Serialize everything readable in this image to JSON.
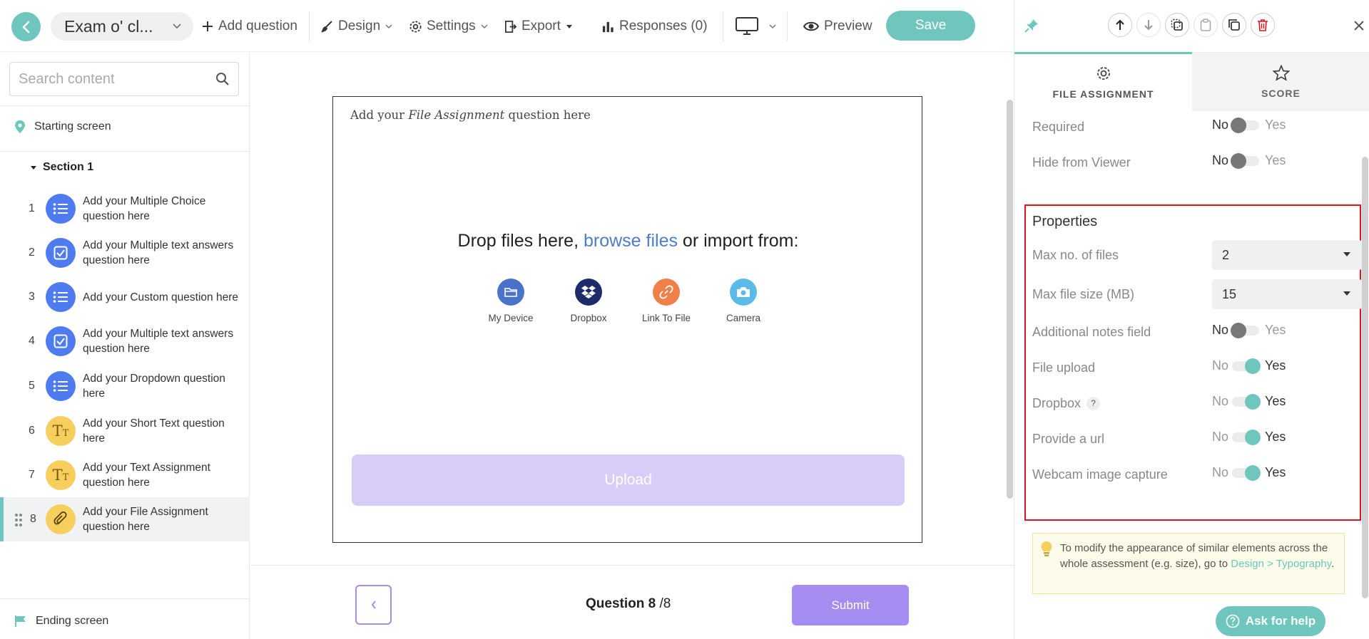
{
  "header": {
    "title": "Exam o' cl...",
    "add_question": "Add question",
    "design": "Design",
    "settings": "Settings",
    "export": "Export",
    "responses": "Responses (0)",
    "preview": "Preview",
    "save": "Save"
  },
  "sidebar": {
    "search_placeholder": "Search content",
    "starting_screen": "Starting screen",
    "section": "Section 1",
    "questions": [
      {
        "num": "1",
        "label": "Add your Multiple Choice question here",
        "icon": "list-icon",
        "color": "#4e7cf0"
      },
      {
        "num": "2",
        "label": "Add your Multiple text answers question here",
        "icon": "checkbox-icon",
        "color": "#4e7cf0"
      },
      {
        "num": "3",
        "label": "Add your Custom question here",
        "icon": "list-icon",
        "color": "#4e7cf0"
      },
      {
        "num": "4",
        "label": "Add your Multiple text answers question here",
        "icon": "checkbox-icon",
        "color": "#4e7cf0"
      },
      {
        "num": "5",
        "label": "Add your Dropdown question here",
        "icon": "list-icon",
        "color": "#4e7cf0"
      },
      {
        "num": "6",
        "label": "Add your Short Text question here",
        "icon": "text-icon",
        "color": "#f6cf5e"
      },
      {
        "num": "7",
        "label": "Add your Text Assignment question here",
        "icon": "text-icon",
        "color": "#f6cf5e"
      },
      {
        "num": "8",
        "label": "Add your File Assignment question here",
        "icon": "paperclip-icon",
        "color": "#f6cf5e"
      }
    ],
    "ending_screen": "Ending screen"
  },
  "canvas": {
    "question_prefix": "Add your ",
    "question_italic": "File Assignment",
    "question_suffix": " question here",
    "drop_prefix": "Drop files here, ",
    "drop_link": "browse files",
    "drop_suffix": " or import from:",
    "sources": [
      {
        "label": "My Device",
        "icon": "folder-icon",
        "color": "#4a72c8"
      },
      {
        "label": "Dropbox",
        "icon": "dropbox-icon",
        "color": "#1f2a6b"
      },
      {
        "label": "Link To File",
        "icon": "link-icon",
        "color": "#ef8049"
      },
      {
        "label": "Camera",
        "icon": "camera-icon",
        "color": "#5bbbe8"
      }
    ],
    "upload": "Upload"
  },
  "footer": {
    "question_label": "Question 8",
    "question_total": "/8",
    "submit": "Submit"
  },
  "panel": {
    "tab_file": "FILE ASSIGNMENT",
    "tab_score": "SCORE",
    "no": "No",
    "yes": "Yes",
    "required": {
      "label": "Required",
      "on": false
    },
    "hide_from_viewer": {
      "label": "Hide from Viewer",
      "on": false
    },
    "properties_title": "Properties",
    "max_files": {
      "label": "Max no. of files",
      "value": "2"
    },
    "max_size": {
      "label": "Max file size (MB)",
      "value": "15"
    },
    "additional_notes": {
      "label": "Additional notes field",
      "on": false
    },
    "file_upload": {
      "label": "File upload",
      "on": true
    },
    "dropbox": {
      "label": "Dropbox",
      "help": "?",
      "on": true
    },
    "provide_url": {
      "label": "Provide a url",
      "on": true
    },
    "webcam": {
      "label": "Webcam image capture",
      "on": true
    },
    "tip_text": "To modify the appearance of similar elements across the whole assessment (e.g. size), go to ",
    "tip_link": "Design > Typography",
    "tip_end": ".",
    "ask_help": "Ask for help"
  },
  "colors": {
    "accent": "#6fc6bd",
    "purple": "#a58cf0",
    "highlight_border": "#e3131b"
  }
}
